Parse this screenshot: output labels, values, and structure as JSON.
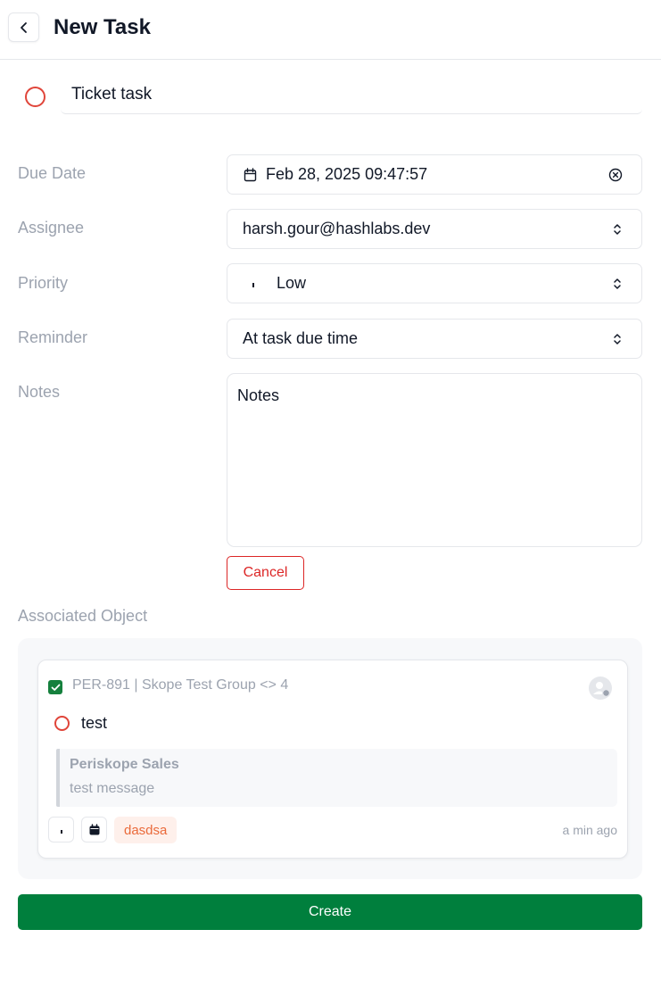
{
  "header": {
    "title": "New Task"
  },
  "task": {
    "title": "Ticket task"
  },
  "fields": {
    "due_date": {
      "label": "Due Date",
      "value": "Feb 28, 2025 09:47:57"
    },
    "assignee": {
      "label": "Assignee",
      "value": "harsh.gour@hashlabs.dev"
    },
    "priority": {
      "label": "Priority",
      "value": "Low"
    },
    "reminder": {
      "label": "Reminder",
      "value": "At task due time"
    },
    "notes": {
      "label": "Notes",
      "value": "Notes"
    }
  },
  "cancel_label": "Cancel",
  "associated": {
    "label": "Associated Object",
    "ref": "PER-891 | Skope Test Group <> 4",
    "checked": true,
    "task_title": "test",
    "quote_author": "Periskope Sales",
    "quote_message": "test message",
    "tag": "dasdsa",
    "time_ago": "a min ago"
  },
  "create_label": "Create",
  "colors": {
    "primary_green": "#007f3d",
    "status_red": "#e0453a",
    "danger": "#dc2626",
    "tag_text": "#ea6a3a",
    "tag_bg": "#fef0eb"
  },
  "icons": [
    "chevron-left-icon",
    "calendar-icon",
    "clear-icon",
    "chevron-up-down-icon",
    "priority-low-icon",
    "checkmark-icon",
    "avatar-icon",
    "calendar-filled-icon"
  ]
}
